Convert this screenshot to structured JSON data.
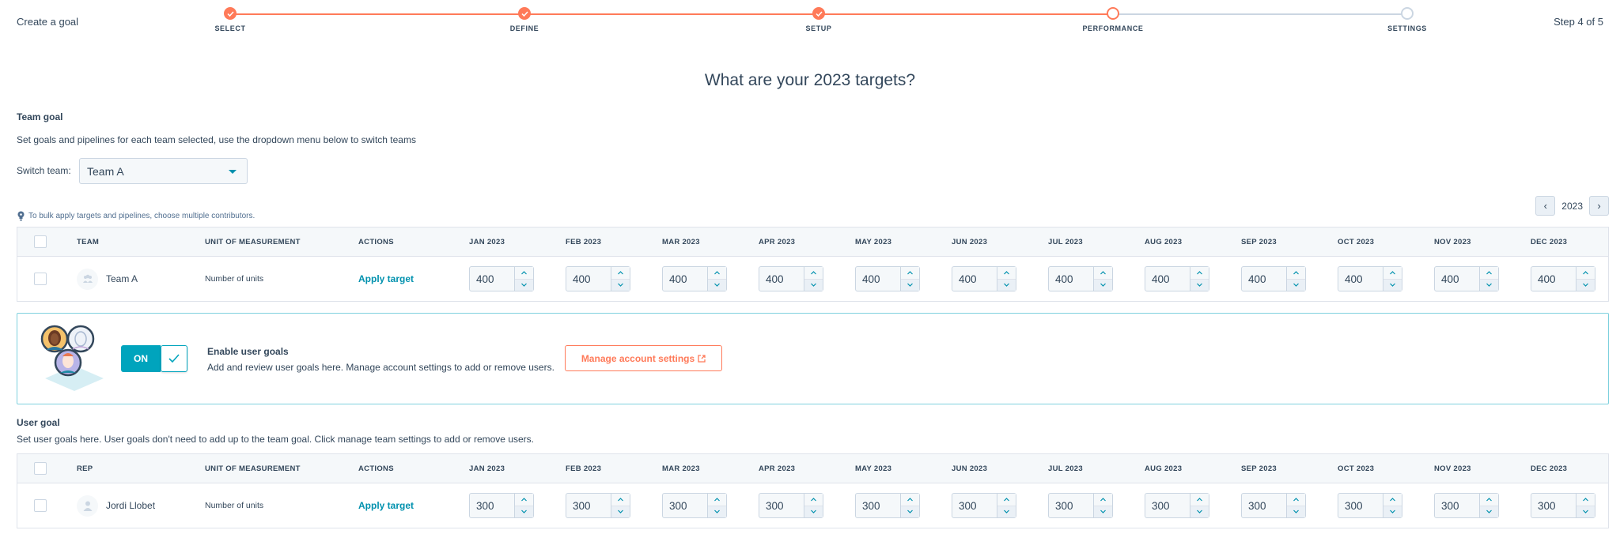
{
  "header": {
    "title": "Create a goal",
    "step_count": "Step 4 of 5",
    "steps": [
      {
        "label": "SELECT",
        "state": "done"
      },
      {
        "label": "DEFINE",
        "state": "done"
      },
      {
        "label": "SETUP",
        "state": "done"
      },
      {
        "label": "PERFORMANCE",
        "state": "current"
      },
      {
        "label": "SETTINGS",
        "state": "todo"
      }
    ]
  },
  "page_heading": "What are your 2023 targets?",
  "team_goal": {
    "title": "Team goal",
    "description": "Set goals and pipelines for each team selected, use the dropdown menu below to switch teams",
    "switch_label": "Switch team:",
    "selected_team": "Team A",
    "tip": "To bulk apply targets and pipelines, choose multiple contributors.",
    "year": "2023",
    "columns": {
      "entity": "TEAM",
      "unit": "UNIT OF MEASUREMENT",
      "actions": "ACTIONS"
    },
    "rows": [
      {
        "name": "Team A",
        "unit": "Number of units",
        "action": "Apply target",
        "values": [
          "400",
          "400",
          "400",
          "400",
          "400",
          "400",
          "400",
          "400",
          "400",
          "400",
          "400",
          "400"
        ]
      }
    ]
  },
  "months": [
    "JAN 2023",
    "FEB 2023",
    "MAR 2023",
    "APR 2023",
    "MAY 2023",
    "JUN 2023",
    "JUL 2023",
    "AUG 2023",
    "SEP 2023",
    "OCT 2023",
    "NOV 2023",
    "DEC 2023"
  ],
  "banner": {
    "toggle_label": "ON",
    "title": "Enable user goals",
    "description": "Add and review user goals here. Manage account settings to add or remove users.",
    "button_label": "Manage account settings"
  },
  "user_goal": {
    "title": "User goal",
    "description": "Set user goals here. User goals don't need to add up to the team goal. Click manage team settings to add or remove users.",
    "columns": {
      "entity": "REP",
      "unit": "UNIT OF MEASUREMENT",
      "actions": "ACTIONS"
    },
    "rows": [
      {
        "name": "Jordi Llobet",
        "unit": "Number of units",
        "action": "Apply target",
        "values": [
          "300",
          "300",
          "300",
          "300",
          "300",
          "300",
          "300",
          "300",
          "300",
          "300",
          "300",
          "300"
        ]
      }
    ]
  },
  "colors": {
    "accent": "#ff7a59",
    "link": "#0091ae",
    "toggle_on": "#00a4bd",
    "text": "#33475b"
  }
}
